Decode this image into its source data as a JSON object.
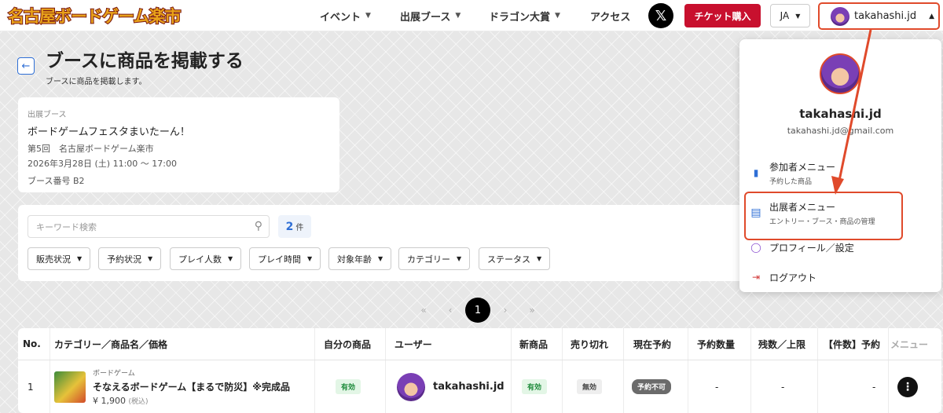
{
  "header": {
    "logo_text": "名古屋ボードゲーム楽市",
    "nav": [
      "イベント",
      "出展ブース",
      "ドラゴン大賞",
      "アクセス"
    ],
    "x_icon": "x-logo-icon",
    "ticket_label": "チケット購入",
    "lang": "JA",
    "user": "takahashi.jd"
  },
  "page": {
    "back_icon": "arrow-left-icon",
    "title": "ブースに商品を掲載する",
    "subtitle": "ブースに商品を掲載します。"
  },
  "booth": {
    "label": "出展ブース",
    "name": "ボードゲームフェスタまいたーん！",
    "event": "第5回　名古屋ボードゲーム楽市",
    "datetime": "2026年3月28日 (土) 11:00 〜 17:00",
    "number": "ブース番号  B2"
  },
  "filters": {
    "search_placeholder": "キーワード検索",
    "count": "2",
    "count_unit": "件",
    "buttons": [
      "販売状況",
      "予約状況",
      "プレイ人数",
      "プレイ時間",
      "対象年齢",
      "カテゴリー",
      "ステータス"
    ]
  },
  "pagination": {
    "first": "«",
    "prev": "‹",
    "current": "1",
    "next": "›",
    "last": "»"
  },
  "table": {
    "headers": [
      "No.",
      "カテゴリー／商品名／価格",
      "自分の商品",
      "ユーザー",
      "新商品",
      "売り切れ",
      "現在予約",
      "予約数量",
      "残数／上限",
      "【件数】予約",
      "メニュー"
    ],
    "rows": [
      {
        "no": "1",
        "category": "ボードゲーム",
        "name": "そなえるボードゲーム【まるで防災】※完成品",
        "price": "¥ 1,900",
        "tax": "(税込)",
        "own": "有効",
        "user": "takahashi.jd",
        "new_item": "有効",
        "sold_out": "無効",
        "reservation": "予約不可",
        "reserve_qty": "-",
        "remaining": "-",
        "count_reserve": "-"
      }
    ]
  },
  "dropdown": {
    "name": "takahashi.jd",
    "email": "takahashi.jd@gmail.com",
    "items": [
      {
        "title": "参加者メニュー",
        "sub": "予約した商品",
        "icon": "shopping-bag-icon"
      },
      {
        "title": "出展者メニュー",
        "sub": "エントリー・ブース・商品の管理",
        "icon": "store-icon"
      },
      {
        "title": "プロフィール／設定",
        "sub": "",
        "icon": "user-icon"
      },
      {
        "title": "ログアウト",
        "sub": "",
        "icon": "logout-icon"
      }
    ]
  },
  "colors": {
    "accent": "#c8102e",
    "link": "#2f6fd6",
    "annotation": "#e04a2b"
  }
}
